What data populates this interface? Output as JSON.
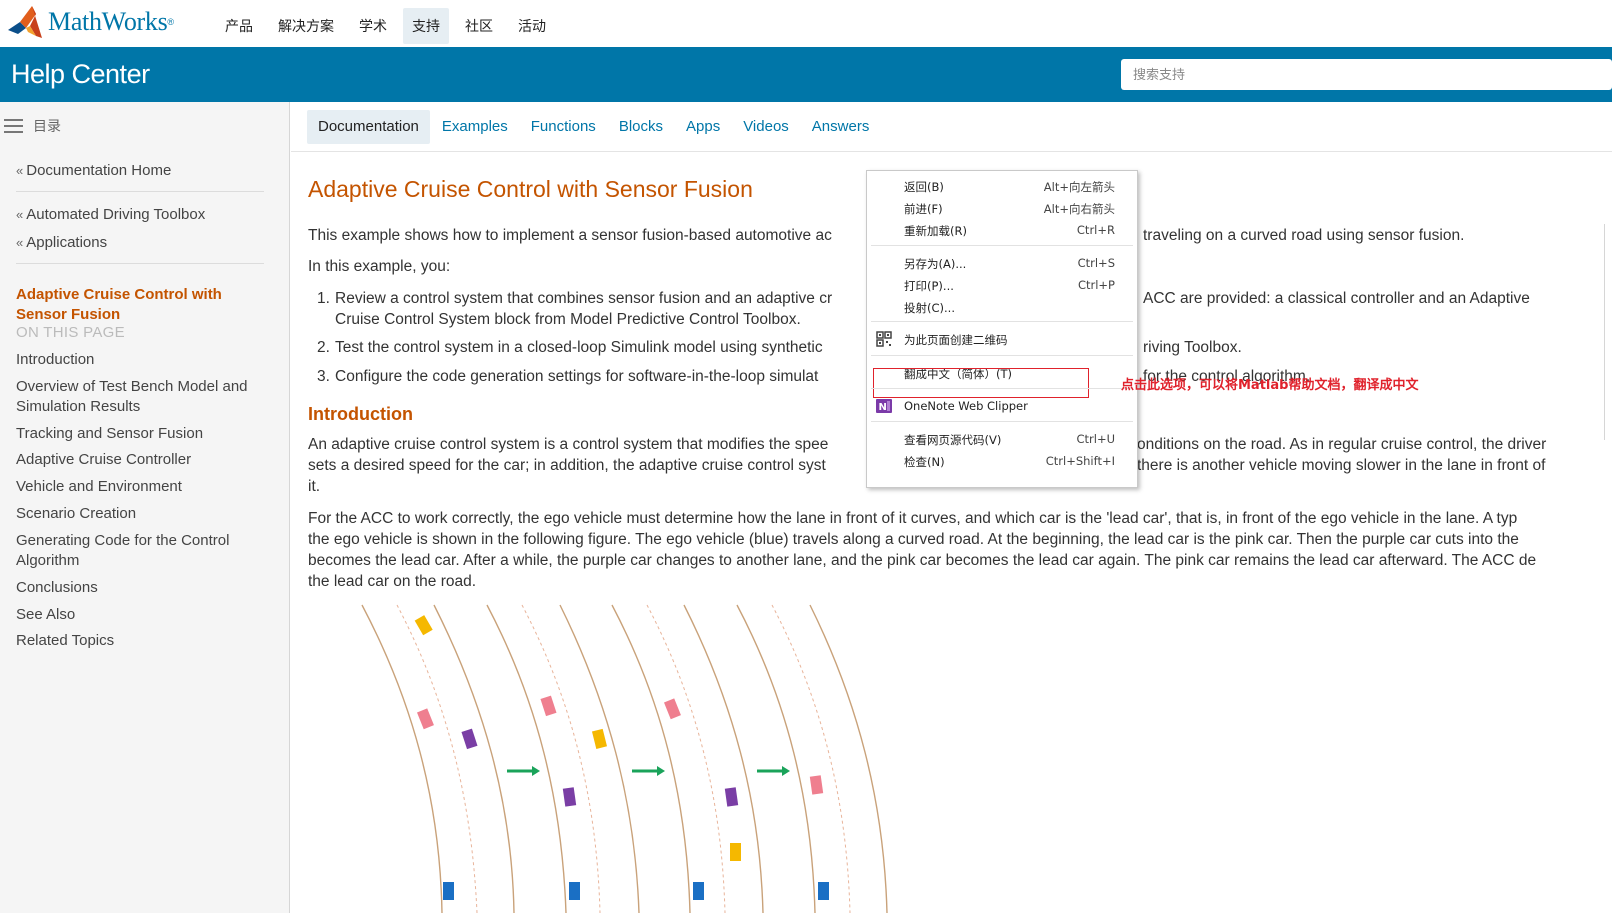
{
  "brand": {
    "name": "MathWorks",
    "reg": "®"
  },
  "topnav": {
    "items": [
      "产品",
      "解决方案",
      "学术",
      "支持",
      "社区",
      "活动"
    ],
    "active_index": 3
  },
  "helpbar": {
    "title": "Help Center",
    "search_placeholder": "搜索支持"
  },
  "sidebar": {
    "toc_label": "目录",
    "links": [
      "Documentation Home",
      "Automated Driving Toolbox",
      "Applications"
    ],
    "current": "Adaptive Cruise Control with Sensor Fusion",
    "on_this_page_label": "ON THIS PAGE",
    "sections": [
      "Introduction",
      "Overview of Test Bench Model and Simulation Results",
      "Tracking and Sensor Fusion",
      "Adaptive Cruise Controller",
      "Vehicle and Environment",
      "Scenario Creation",
      "Generating Code for the Control Algorithm",
      "Conclusions",
      "See Also",
      "Related Topics"
    ]
  },
  "tabs": [
    "Documentation",
    "Examples",
    "Functions",
    "Blocks",
    "Apps",
    "Videos",
    "Answers"
  ],
  "article": {
    "title": "Adaptive Cruise Control with Sensor Fusion",
    "intro_left": "This example shows how to implement a sensor fusion-based automotive ac",
    "intro_right": "traveling on a curved road using sensor fusion.",
    "in_this_example": "In this example, you:",
    "list": [
      {
        "num": "1.",
        "left": "Review a control system that combines sensor fusion and an adaptive cr",
        "right": "ACC are provided: a classical controller and an Adaptive",
        "line2": "Cruise Control System block from Model Predictive Control Toolbox."
      },
      {
        "num": "2.",
        "left": "Test the control system in a closed-loop Simulink model using synthetic",
        "right": "riving Toolbox."
      },
      {
        "num": "3.",
        "left": "Configure the code generation settings for software-in-the-loop simulat",
        "right": "for the control algorithm."
      }
    ],
    "intro_heading": "Introduction",
    "p1_l1_left": "An adaptive cruise control system is a control system that modifies the spee",
    "p1_l1_right": "onditions on the road. As in regular cruise control, the driver",
    "p1_l2_left": "sets a desired speed for the car; in addition, the adaptive cruise control syst",
    "p1_l2_right": "there is another vehicle moving slower in the lane in front of",
    "p1_l3": "it.",
    "p2": [
      "For the ACC to work correctly, the ego vehicle must determine how the lane in front of it curves, and which car is the 'lead car', that is, in front of the ego vehicle in the lane. A typ",
      "the ego vehicle is shown in the following figure. The ego vehicle (blue) travels along a curved road. At the beginning, the lead car is the pink car. Then the purple car cuts into the",
      "becomes the lead car. After a while, the purple car changes to another lane, and the pink car becomes the lead car again. The pink car remains the lead car afterward. The ACC de",
      "the lead car on the road."
    ]
  },
  "context_menu": {
    "items": [
      {
        "label": "返回(B)",
        "shortcut": "Alt+向左箭头"
      },
      {
        "label": "前进(F)",
        "shortcut": "Alt+向右箭头"
      },
      {
        "label": "重新加载(R)",
        "shortcut": "Ctrl+R"
      },
      {
        "label": "另存为(A)...",
        "shortcut": "Ctrl+S"
      },
      {
        "label": "打印(P)...",
        "shortcut": "Ctrl+P"
      },
      {
        "label": "投射(C)...",
        "shortcut": ""
      },
      {
        "label": "为此页面创建二维码",
        "shortcut": "",
        "icon": "qr-code-icon"
      },
      {
        "label": "翻成中文（简体）(T)",
        "shortcut": ""
      },
      {
        "label": "OneNote Web Clipper",
        "shortcut": "",
        "icon": "onenote-icon"
      },
      {
        "label": "查看网页源代码(V)",
        "shortcut": "Ctrl+U"
      },
      {
        "label": "检查(N)",
        "shortcut": "Ctrl+Shift+I"
      }
    ]
  },
  "annotation": "点击此选项，可以将Matlab帮助文档，翻译成中文",
  "colors": {
    "brand_blue": "#0076a8",
    "title_orange": "#c45400",
    "annotation_red": "#e0222c",
    "car_yellow": "#f5b800",
    "car_pink": "#ef7f8f",
    "car_purple": "#7a3ea5",
    "car_blue": "#1a6fc4",
    "arrow_green": "#1aa35a"
  }
}
